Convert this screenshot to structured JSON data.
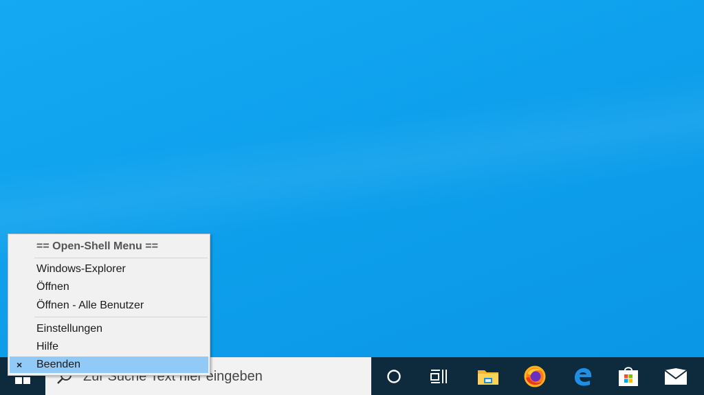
{
  "desktop": {
    "background_color": "#12a3ee"
  },
  "taskbar": {
    "background_color": "#0e2a3d",
    "search": {
      "placeholder": "Zur Suche Text hier eingeben"
    },
    "icons": [
      {
        "name": "start-windows-icon"
      },
      {
        "name": "cortana-icon"
      },
      {
        "name": "task-view-icon"
      },
      {
        "name": "file-explorer-icon"
      },
      {
        "name": "firefox-icon"
      },
      {
        "name": "edge-icon"
      },
      {
        "name": "microsoft-store-icon"
      },
      {
        "name": "mail-icon"
      }
    ]
  },
  "context_menu": {
    "header": "== Open-Shell Menu ==",
    "items": [
      {
        "label": "Windows-Explorer"
      },
      {
        "label": "Öffnen"
      },
      {
        "label": "Öffnen - Alle Benutzer"
      },
      {
        "label": "Einstellungen"
      },
      {
        "label": "Hilfe"
      },
      {
        "label": "Beenden",
        "selected": true,
        "check_glyph": "×"
      }
    ],
    "selection_color": "#91c9f7"
  }
}
